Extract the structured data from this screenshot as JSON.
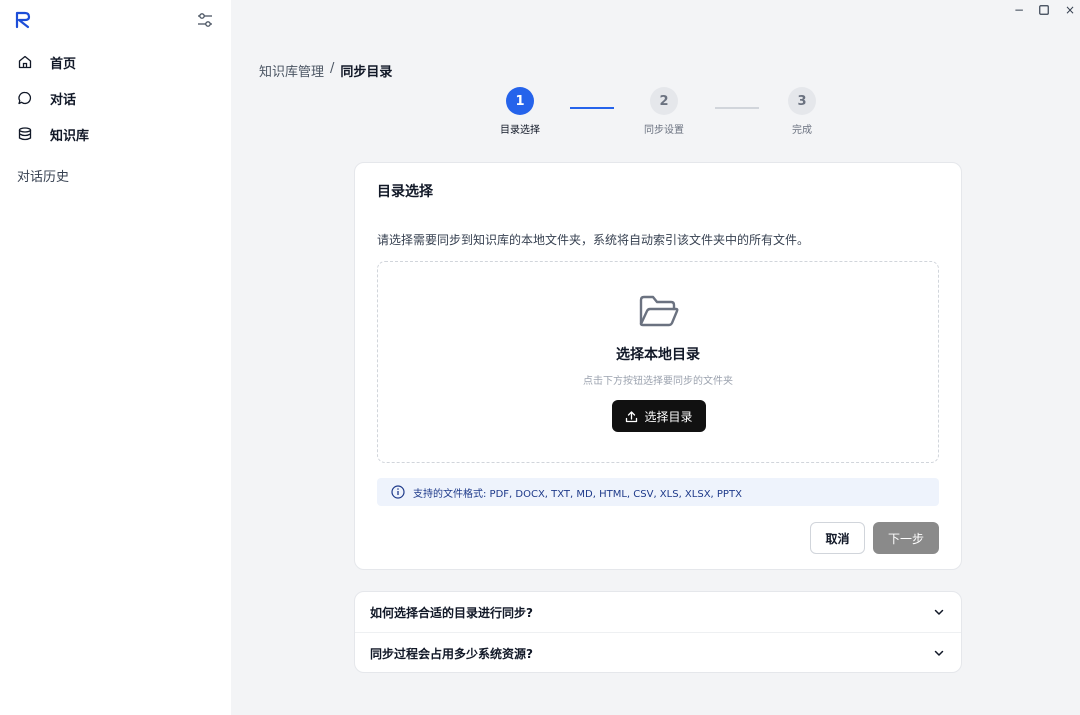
{
  "sidebar": {
    "items": [
      {
        "label": "首页",
        "icon": "home-icon"
      },
      {
        "label": "对话",
        "icon": "chat-icon"
      },
      {
        "label": "知识库",
        "icon": "database-icon"
      }
    ],
    "history_label": "对话历史"
  },
  "window": {
    "minimize": "−",
    "maximize": "☐",
    "close": "×"
  },
  "breadcrumb": {
    "parent": "知识库管理",
    "separator": "/",
    "current": "同步目录"
  },
  "stepper": {
    "steps": [
      {
        "number": "1",
        "label": "目录选择"
      },
      {
        "number": "2",
        "label": "同步设置"
      },
      {
        "number": "3",
        "label": "完成"
      }
    ],
    "active_step": 1
  },
  "card": {
    "title": "目录选择",
    "description": "请选择需要同步到知识库的本地文件夹，系统将自动索引该文件夹中的所有文件。",
    "dropzone": {
      "title": "选择本地目录",
      "subtitle": "点击下方按钮选择要同步的文件夹",
      "button_label": "选择目录"
    },
    "info": "支持的文件格式: PDF, DOCX, TXT, MD, HTML, CSV, XLS, XLSX, PPTX",
    "cancel_label": "取消",
    "next_label": "下一步"
  },
  "faq": [
    {
      "question": "如何选择合适的目录进行同步?"
    },
    {
      "question": "同步过程会占用多少系统资源?"
    }
  ],
  "colors": {
    "accent": "#2563eb",
    "primary_button": "#111111",
    "disabled_button": "#8a8a8a",
    "info_bg": "#eef3fc"
  }
}
